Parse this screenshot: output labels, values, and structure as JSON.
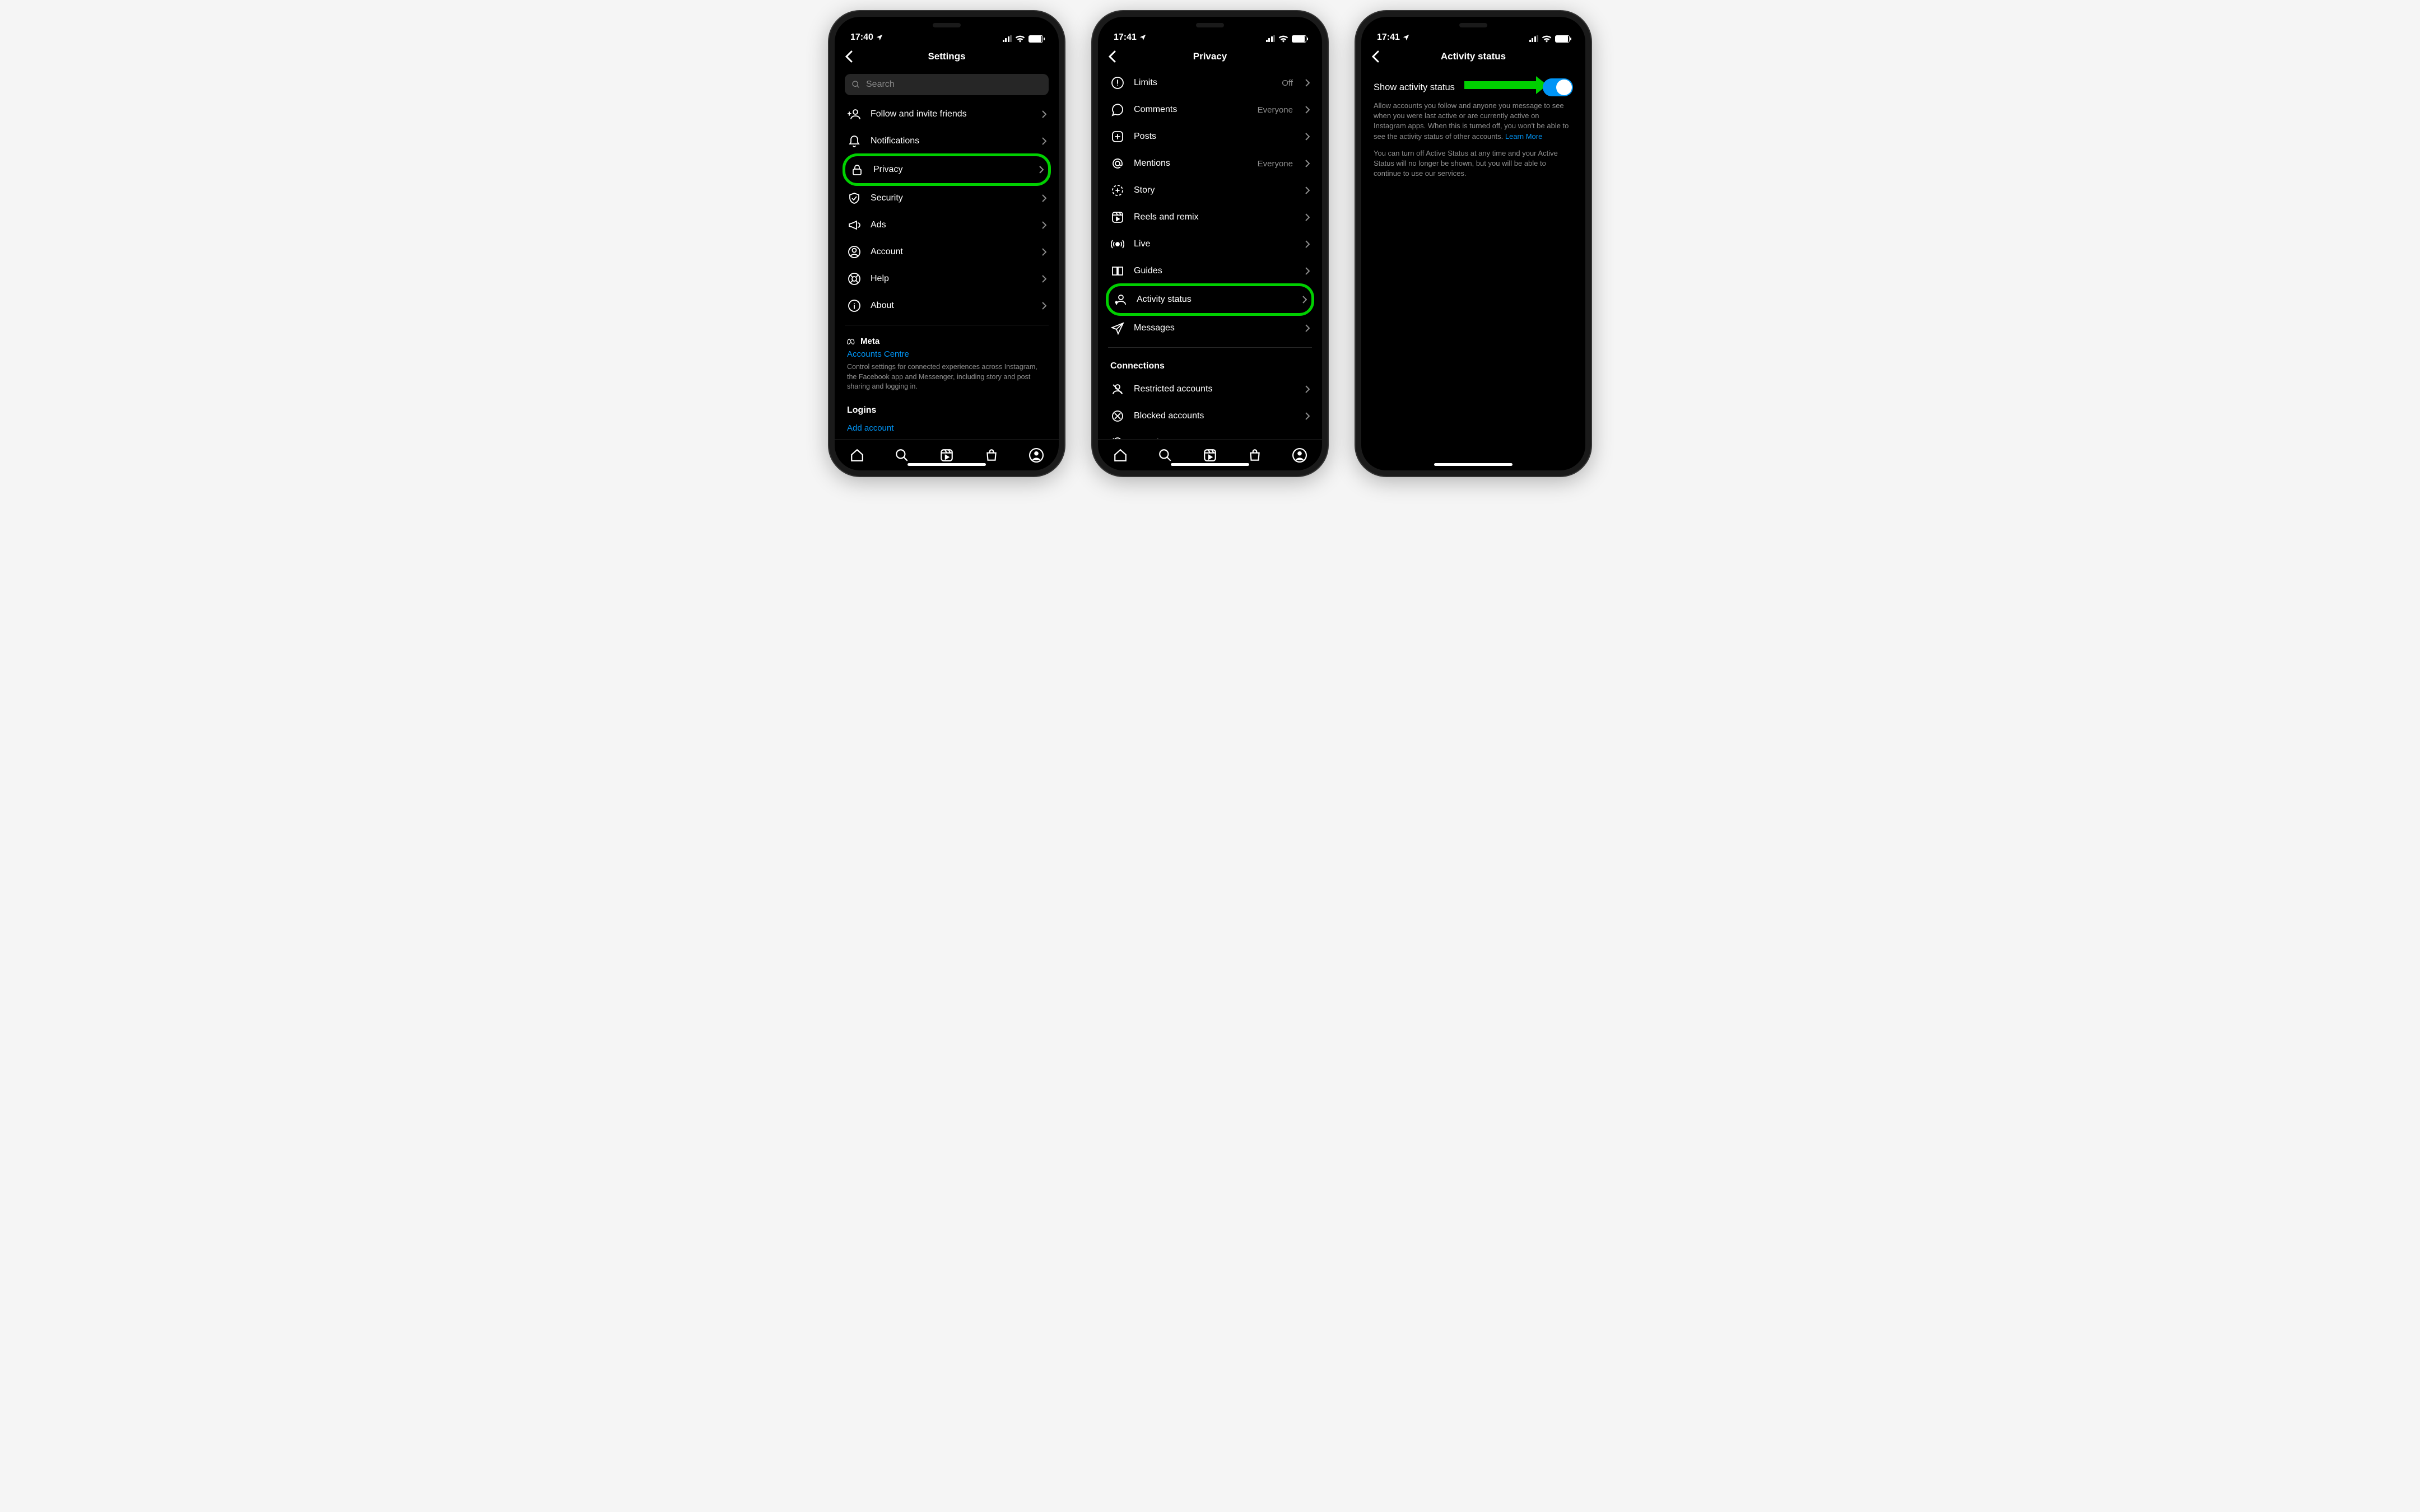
{
  "annotation_color": "#00d000",
  "accent_color": "#0095f6",
  "screens": [
    {
      "time": "17:40",
      "title": "Settings",
      "search_placeholder": "Search",
      "items": [
        {
          "icon": "invite",
          "label": "Follow and invite friends"
        },
        {
          "icon": "bell",
          "label": "Notifications"
        },
        {
          "icon": "lock",
          "label": "Privacy",
          "highlight": true
        },
        {
          "icon": "shield",
          "label": "Security"
        },
        {
          "icon": "megaphone",
          "label": "Ads"
        },
        {
          "icon": "user-circle",
          "label": "Account"
        },
        {
          "icon": "lifebuoy",
          "label": "Help"
        },
        {
          "icon": "info",
          "label": "About"
        }
      ],
      "meta_brand": "Meta",
      "meta_link": "Accounts Centre",
      "meta_caption": "Control settings for connected experiences across Instagram, the Facebook app and Messenger, including story and post sharing and logging in.",
      "logins_header": "Logins",
      "add_account": "Add account"
    },
    {
      "time": "17:41",
      "title": "Privacy",
      "items": [
        {
          "icon": "limits",
          "label": "Limits",
          "detail": "Off"
        },
        {
          "icon": "comment",
          "label": "Comments",
          "detail": "Everyone"
        },
        {
          "icon": "plus-square",
          "label": "Posts"
        },
        {
          "icon": "at",
          "label": "Mentions",
          "detail": "Everyone"
        },
        {
          "icon": "story",
          "label": "Story"
        },
        {
          "icon": "reels",
          "label": "Reels and remix"
        },
        {
          "icon": "live",
          "label": "Live"
        },
        {
          "icon": "guides",
          "label": "Guides"
        },
        {
          "icon": "activity",
          "label": "Activity status",
          "highlight": true
        },
        {
          "icon": "send",
          "label": "Messages"
        }
      ],
      "connections_header": "Connections",
      "connections": [
        {
          "icon": "restricted",
          "label": "Restricted accounts"
        },
        {
          "icon": "blocked",
          "label": "Blocked accounts"
        },
        {
          "icon": "muted",
          "label": "Muted accounts"
        }
      ]
    },
    {
      "time": "17:41",
      "title": "Activity status",
      "toggle_label": "Show activity status",
      "toggle_on": true,
      "desc1": "Allow accounts you follow and anyone you message to see when you were last active or are currently active on Instagram apps. When this is turned off, you won't be able to see the activity status of other accounts.",
      "learn_more": "Learn More",
      "desc2": "You can turn off Active Status at any time and your Active Status will no longer be shown, but you will be able to continue to use our services."
    }
  ]
}
